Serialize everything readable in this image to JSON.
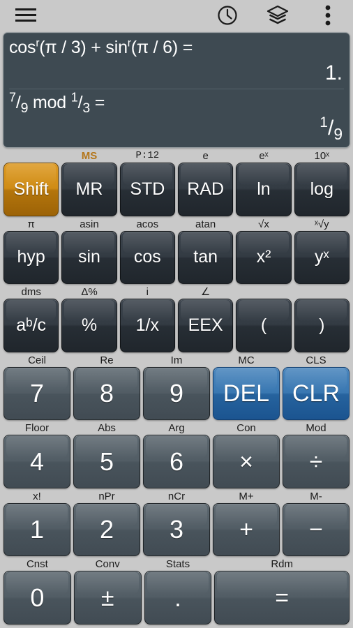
{
  "topbar": {
    "menu_icon": "hamburger-menu-icon",
    "history_icon": "clock-history-icon",
    "layers_icon": "layers-icon",
    "overflow_icon": "overflow-menu-icon"
  },
  "display": {
    "entries": [
      {
        "expression": "cosʳ(π / 3) + sinʳ(π / 6) =",
        "result": "1."
      },
      {
        "expression": "⁷/₉ mod ¹/₃ =",
        "result": "¹/₉"
      }
    ],
    "background_color": "#3e4a52",
    "text_color": "#ffffff"
  },
  "keypad": {
    "colors": {
      "accent": "#cf8c16",
      "blue": "#2a6aa5",
      "function_key": "#333b43",
      "number_key": "#525d65",
      "panel": "#c9c9c9"
    },
    "rows": [
      {
        "keys": [
          {
            "shift": "",
            "label": "Shift",
            "style": "accent",
            "size": "small"
          },
          {
            "shift": "MS",
            "label": "MR",
            "style": "fn",
            "size": "small",
            "shift_color": "orange"
          },
          {
            "shift": "P:12",
            "label": "STD",
            "style": "fn",
            "size": "small",
            "shift_font": "mono"
          },
          {
            "shift": "e",
            "label": "RAD",
            "style": "fn",
            "size": "small"
          },
          {
            "shift": "eˣ",
            "label": "ln",
            "style": "fn",
            "size": "small"
          },
          {
            "shift": "10ˣ",
            "label": "log",
            "style": "fn",
            "size": "small"
          }
        ]
      },
      {
        "keys": [
          {
            "shift": "π",
            "label": "hyp",
            "style": "fn",
            "size": "small"
          },
          {
            "shift": "asin",
            "label": "sin",
            "style": "fn",
            "size": "small"
          },
          {
            "shift": "acos",
            "label": "cos",
            "style": "fn",
            "size": "small"
          },
          {
            "shift": "atan",
            "label": "tan",
            "style": "fn",
            "size": "small"
          },
          {
            "shift": "√x",
            "label": "x²",
            "style": "fn",
            "size": "small"
          },
          {
            "shift": "ˣ√y",
            "label": "yˣ",
            "style": "fn",
            "size": "small"
          }
        ]
      },
      {
        "keys": [
          {
            "shift": "dms",
            "label": "aᵇ/ᴄ",
            "style": "fn",
            "size": "small"
          },
          {
            "shift": "Δ%",
            "label": "%",
            "style": "fn",
            "size": "small"
          },
          {
            "shift": "i",
            "label": "1/x",
            "style": "fn",
            "size": "small"
          },
          {
            "shift": "∠",
            "label": "EEX",
            "style": "fn",
            "size": "small"
          },
          {
            "shift": "",
            "label": "(",
            "style": "fn",
            "size": "small"
          },
          {
            "shift": "",
            "label": ")",
            "style": "fn",
            "size": "small"
          }
        ]
      },
      {
        "keys": [
          {
            "shift": "Ceil",
            "label": "7",
            "style": "num",
            "size": "digit"
          },
          {
            "shift": "Re",
            "label": "8",
            "style": "num",
            "size": "digit"
          },
          {
            "shift": "Im",
            "label": "9",
            "style": "num",
            "size": "digit"
          },
          {
            "shift": "MC",
            "label": "DEL",
            "style": "blue",
            "size": "op"
          },
          {
            "shift": "CLS",
            "label": "CLR",
            "style": "blue",
            "size": "op"
          }
        ]
      },
      {
        "keys": [
          {
            "shift": "Floor",
            "label": "4",
            "style": "num",
            "size": "digit"
          },
          {
            "shift": "Abs",
            "label": "5",
            "style": "num",
            "size": "digit"
          },
          {
            "shift": "Arg",
            "label": "6",
            "style": "num",
            "size": "digit"
          },
          {
            "shift": "Con",
            "label": "×",
            "style": "num",
            "size": "op"
          },
          {
            "shift": "Mod",
            "label": "÷",
            "style": "num",
            "size": "op"
          }
        ]
      },
      {
        "keys": [
          {
            "shift": "x!",
            "label": "1",
            "style": "num",
            "size": "digit"
          },
          {
            "shift": "nPr",
            "label": "2",
            "style": "num",
            "size": "digit"
          },
          {
            "shift": "nCr",
            "label": "3",
            "style": "num",
            "size": "digit"
          },
          {
            "shift": "M+",
            "label": "+",
            "style": "num",
            "size": "op"
          },
          {
            "shift": "M-",
            "label": "−",
            "style": "num",
            "size": "op"
          }
        ]
      },
      {
        "keys": [
          {
            "shift": "Cnst",
            "label": "0",
            "style": "num",
            "size": "digit"
          },
          {
            "shift": "Conv",
            "label": "±",
            "style": "num",
            "size": "op"
          },
          {
            "shift": "Stats",
            "label": ".",
            "style": "num",
            "size": "digit"
          },
          {
            "shift": "Rdm",
            "label": "=",
            "style": "num",
            "size": "eq",
            "wide": 2
          }
        ]
      }
    ]
  }
}
